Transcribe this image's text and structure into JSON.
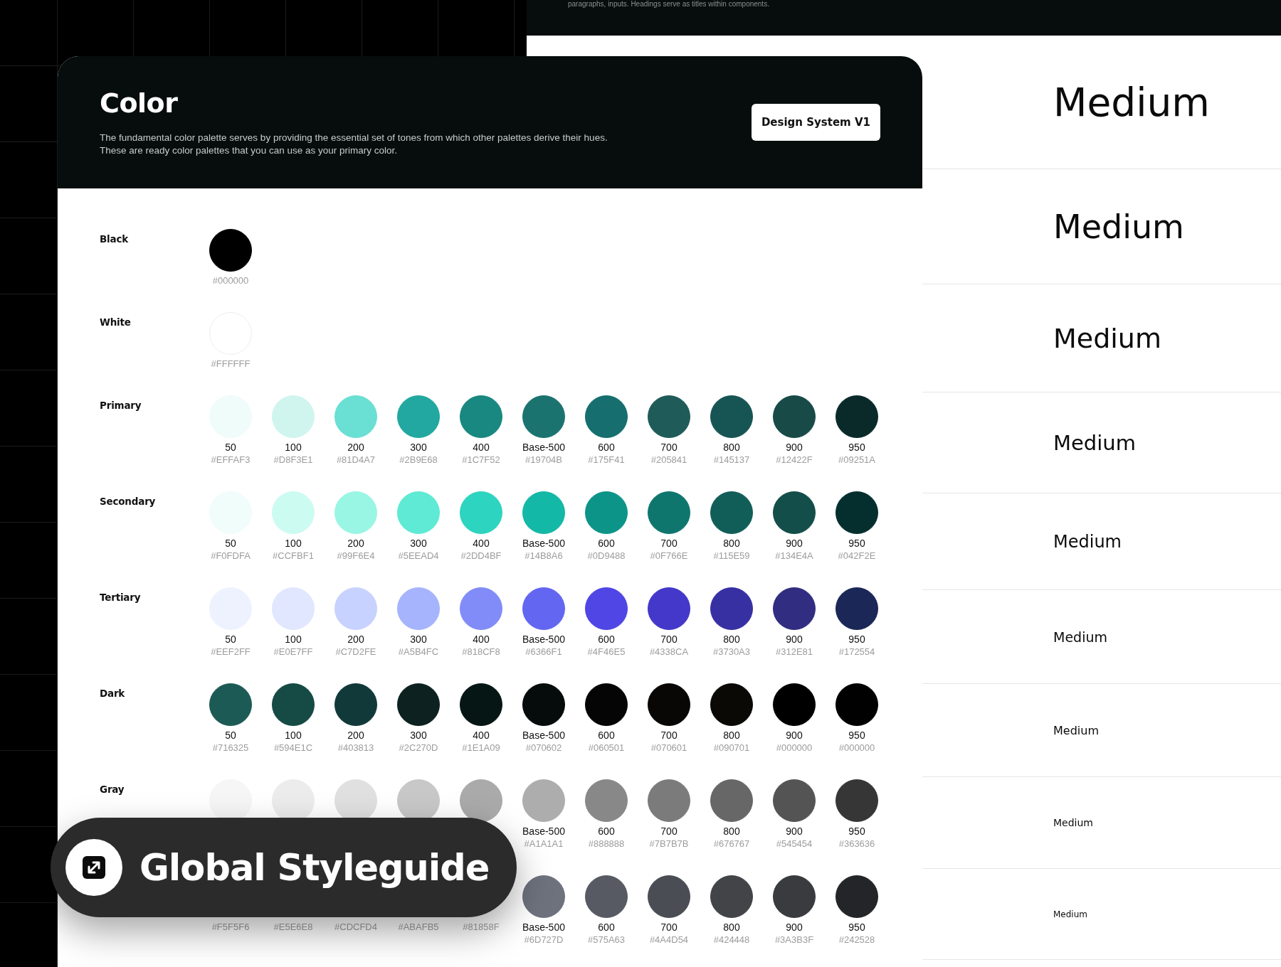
{
  "back_panel": {
    "note": "paragraphs, inputs. Headings serve as titles within components.",
    "samples": [
      "Medium",
      "Medium",
      "Medium",
      "Medium",
      "Medium",
      "Medium",
      "Medium",
      "Medium",
      "Medium"
    ]
  },
  "card": {
    "title": "Color",
    "description": [
      "The fundamental color palette serves by providing the essential set of tones from which other palettes derive their hues.",
      "These are ready color palettes that you can use as your primary color."
    ],
    "button": "Design System V1"
  },
  "palettes": [
    {
      "name": "Black",
      "swatches": [
        {
          "hex": "#000000",
          "color": "#000000"
        }
      ]
    },
    {
      "name": "White",
      "swatches": [
        {
          "hex": "#FFFFFF",
          "color": "#ffffff"
        }
      ]
    },
    {
      "name": "Primary",
      "swatches": [
        {
          "step": "50",
          "hex": "#EFFAF3",
          "color": "#effcf9"
        },
        {
          "step": "100",
          "hex": "#D8F3E1",
          "color": "#d0f5ee"
        },
        {
          "step": "200",
          "hex": "#81D4A7",
          "color": "#6adfd3"
        },
        {
          "step": "300",
          "hex": "#2B9E68",
          "color": "#22a8a0"
        },
        {
          "step": "400",
          "hex": "#1C7F52",
          "color": "#188880"
        },
        {
          "step": "Base-500",
          "hex": "#19704B",
          "color": "#1b7370"
        },
        {
          "step": "600",
          "hex": "#175F41",
          "color": "#166e6e"
        },
        {
          "step": "700",
          "hex": "#205841",
          "color": "#1f5b58"
        },
        {
          "step": "800",
          "hex": "#145137",
          "color": "#175555"
        },
        {
          "step": "900",
          "hex": "#12422F",
          "color": "#184a48"
        },
        {
          "step": "950",
          "hex": "#09251A",
          "color": "#0a2a2a"
        }
      ]
    },
    {
      "name": "Secondary",
      "swatches": [
        {
          "step": "50",
          "hex": "#F0FDFA",
          "color": "#f0fdfa"
        },
        {
          "step": "100",
          "hex": "#CCFBF1",
          "color": "#ccfbf1"
        },
        {
          "step": "200",
          "hex": "#99F6E4",
          "color": "#99f6e4"
        },
        {
          "step": "300",
          "hex": "#5EEAD4",
          "color": "#5eead4"
        },
        {
          "step": "400",
          "hex": "#2DD4BF",
          "color": "#2dd4bf"
        },
        {
          "step": "Base-500",
          "hex": "#14B8A6",
          "color": "#14b8a6"
        },
        {
          "step": "600",
          "hex": "#0D9488",
          "color": "#0d9488"
        },
        {
          "step": "700",
          "hex": "#0F766E",
          "color": "#0f766e"
        },
        {
          "step": "800",
          "hex": "#115E59",
          "color": "#115e59"
        },
        {
          "step": "900",
          "hex": "#134E4A",
          "color": "#134e4a"
        },
        {
          "step": "950",
          "hex": "#042F2E",
          "color": "#042f2e"
        }
      ]
    },
    {
      "name": "Tertiary",
      "swatches": [
        {
          "step": "50",
          "hex": "#EEF2FF",
          "color": "#eef2ff"
        },
        {
          "step": "100",
          "hex": "#E0E7FF",
          "color": "#e0e7ff"
        },
        {
          "step": "200",
          "hex": "#C7D2FE",
          "color": "#c7d2fe"
        },
        {
          "step": "300",
          "hex": "#A5B4FC",
          "color": "#a5b4fc"
        },
        {
          "step": "400",
          "hex": "#818CF8",
          "color": "#818cf8"
        },
        {
          "step": "Base-500",
          "hex": "#6366F1",
          "color": "#6366f1"
        },
        {
          "step": "600",
          "hex": "#4F46E5",
          "color": "#4f46e5"
        },
        {
          "step": "700",
          "hex": "#4338CA",
          "color": "#4338ca"
        },
        {
          "step": "800",
          "hex": "#3730A3",
          "color": "#3730a3"
        },
        {
          "step": "900",
          "hex": "#312E81",
          "color": "#312e81"
        },
        {
          "step": "950",
          "hex": "#172554",
          "color": "#1b2756"
        }
      ]
    },
    {
      "name": "Dark",
      "swatches": [
        {
          "step": "50",
          "hex": "#716325",
          "color": "#1c5b55"
        },
        {
          "step": "100",
          "hex": "#594E1C",
          "color": "#154a45"
        },
        {
          "step": "200",
          "hex": "#403813",
          "color": "#12393a"
        },
        {
          "step": "300",
          "hex": "#2C270D",
          "color": "#0d2220"
        },
        {
          "step": "400",
          "hex": "#1E1A09",
          "color": "#061614"
        },
        {
          "step": "Base-500",
          "hex": "#070602",
          "color": "#050c0b"
        },
        {
          "step": "600",
          "hex": "#060501",
          "color": "#050505"
        },
        {
          "step": "700",
          "hex": "#070601",
          "color": "#090705"
        },
        {
          "step": "800",
          "hex": "#090701",
          "color": "#0b0906"
        },
        {
          "step": "900",
          "hex": "#000000",
          "color": "#000000"
        },
        {
          "step": "950",
          "hex": "#000000",
          "color": "#010101"
        }
      ]
    },
    {
      "name": "Gray",
      "swatches": [
        {
          "color": "#f6f6f6"
        },
        {
          "color": "#ececec"
        },
        {
          "color": "#e0e0e0"
        },
        {
          "color": "#c8c8c8"
        },
        {
          "color": "#aaaaaa"
        },
        {
          "step": "Base-500",
          "hex": "#A1A1A1",
          "color": "#adadad"
        },
        {
          "step": "600",
          "hex": "#888888",
          "color": "#888888"
        },
        {
          "step": "700",
          "hex": "#7B7B7B",
          "color": "#7b7b7b"
        },
        {
          "step": "800",
          "hex": "#676767",
          "color": "#676767"
        },
        {
          "step": "900",
          "hex": "#545454",
          "color": "#545454"
        },
        {
          "step": "950",
          "hex": "#363636",
          "color": "#363636"
        }
      ]
    },
    {
      "swatches": [
        {
          "hex": "#F5F5F6"
        },
        {
          "hex": "#E5E6E8"
        },
        {
          "hex": "#CDCFD4"
        },
        {
          "hex": "#ABAFB5"
        },
        {
          "hex": "#81858F"
        },
        {
          "step": "Base-500",
          "hex": "#6D727D",
          "color": "#6d727d"
        },
        {
          "step": "600",
          "hex": "#575A63",
          "color": "#575a63"
        },
        {
          "step": "700",
          "hex": "#4A4D54",
          "color": "#4a4d54"
        },
        {
          "step": "800",
          "hex": "#424448",
          "color": "#424448"
        },
        {
          "step": "900",
          "hex": "#3A3B3F",
          "color": "#3a3b3f"
        },
        {
          "step": "950",
          "hex": "#242528",
          "color": "#242528"
        }
      ]
    }
  ],
  "badge": {
    "label": "Global Styleguide"
  }
}
